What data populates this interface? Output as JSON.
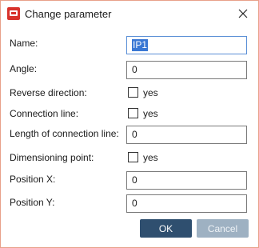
{
  "window": {
    "title": "Change parameter",
    "accent_color": "#d8322b"
  },
  "fields": {
    "name": {
      "label": "Name:",
      "value": "IP1"
    },
    "angle": {
      "label": "Angle:",
      "value": "0"
    },
    "reverse_direction": {
      "label": "Reverse direction:",
      "checkbox_label": "yes",
      "checked": false
    },
    "connection_line": {
      "label": "Connection line:",
      "checkbox_label": "yes",
      "checked": false
    },
    "length_connection_line": {
      "label": "Length of connection line:",
      "value": "0"
    },
    "dimensioning_point": {
      "label": "Dimensioning point:",
      "checkbox_label": "yes",
      "checked": false
    },
    "position_x": {
      "label": "Position X:",
      "value": "0"
    },
    "position_y": {
      "label": "Position Y:",
      "value": "0"
    }
  },
  "buttons": {
    "ok": "OK",
    "cancel": "Cancel",
    "ok_color": "#2f4f6f",
    "cancel_color": "#9eb1c2"
  },
  "icons": {
    "app": "app-logo-icon",
    "close": "close-icon"
  }
}
